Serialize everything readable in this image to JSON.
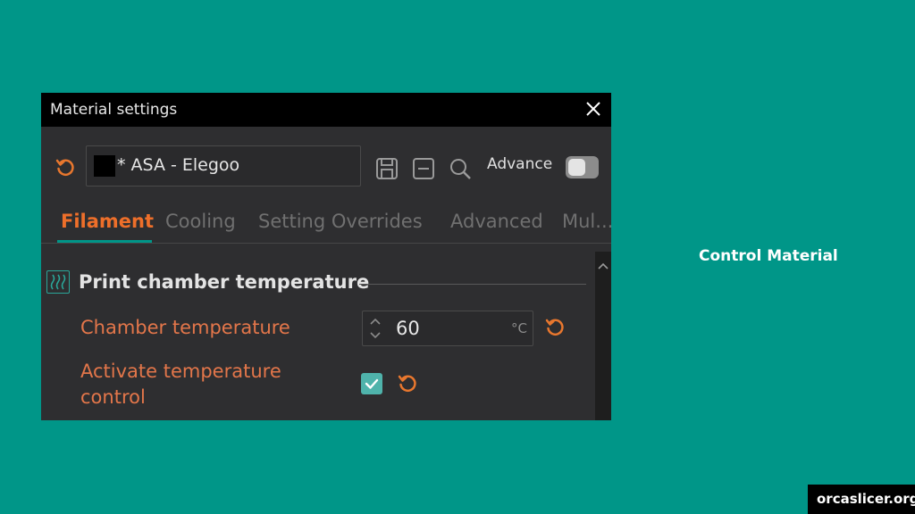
{
  "dialog": {
    "title": "Material settings",
    "preset": {
      "color_swatch": "#000000",
      "name": "* ASA - Elegoo"
    },
    "advance_label": "Advance",
    "advance_enabled": false
  },
  "tabs": [
    {
      "label": "Filament",
      "active": true
    },
    {
      "label": "Cooling",
      "active": false
    },
    {
      "label": "Setting Overrides",
      "active": false
    },
    {
      "label": "Advanced",
      "active": false
    },
    {
      "label": "Mul...",
      "active": false
    }
  ],
  "section": {
    "title": "Print chamber temperature",
    "icon": "heat-waves-icon"
  },
  "fields": {
    "chamber_temperature": {
      "label": "Chamber temperature",
      "value": "60",
      "unit": "°C"
    },
    "activate_temperature_control": {
      "label_line1": "Activate temperature",
      "label_line2": "control",
      "checked": true
    }
  },
  "caption": "Control Material",
  "badge": "orcaslicer.org",
  "colors": {
    "background": "#009688",
    "accent_orange": "#ee6f2a",
    "accent_teal": "#009688",
    "panel": "#2e2e30"
  }
}
